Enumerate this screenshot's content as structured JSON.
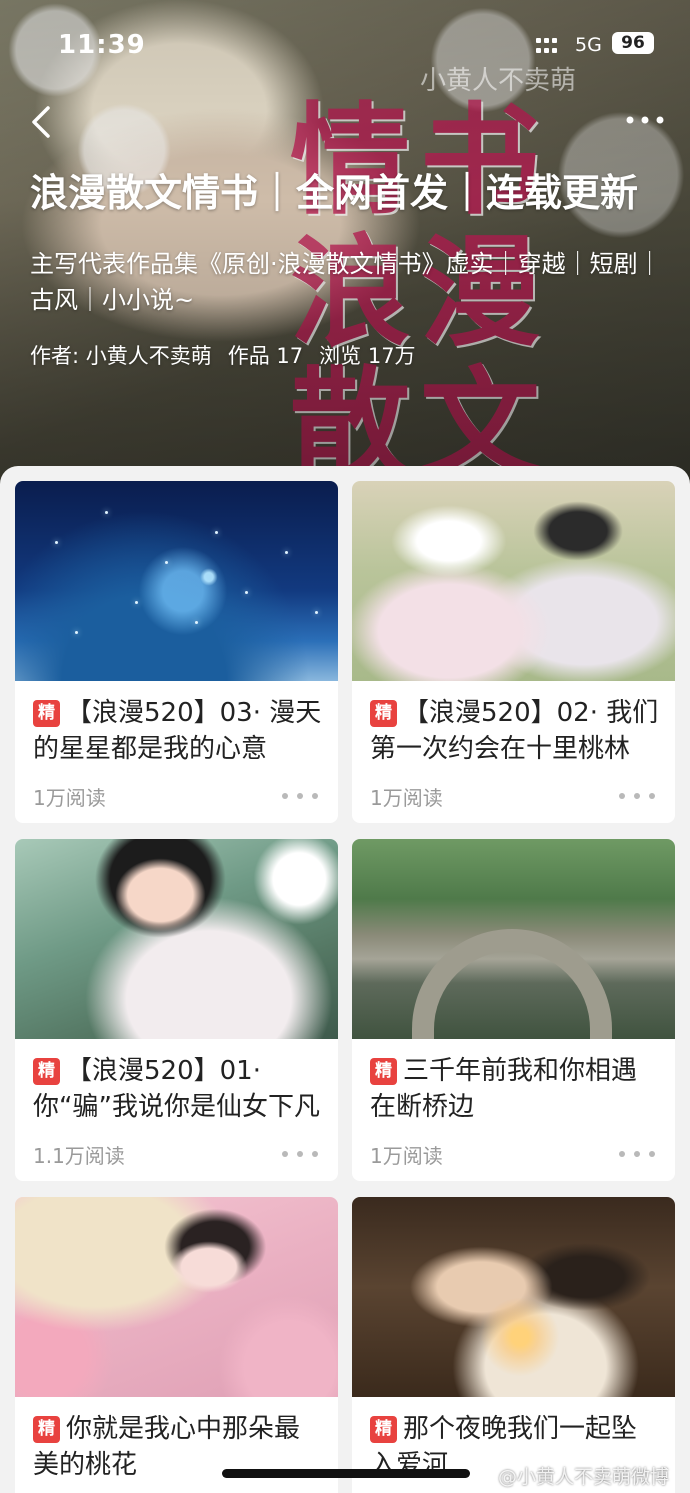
{
  "status_bar": {
    "time": "11:39",
    "network": "5G",
    "battery": "96"
  },
  "hero": {
    "watermark": "小黄人不卖萌",
    "art_text": "情书浪漫散文",
    "title": "浪漫散文情书｜全网首发｜连载更新",
    "description": "主写代表作品集《原创·浪漫散文情书》虚实｜穿越｜短剧｜古风｜小小说~",
    "author": "作者: 小黄人不卖萌",
    "works": "作品 17",
    "views": "浏览 17万"
  },
  "badge_label": "精",
  "cards": [
    {
      "title": "【浪漫520】03· 漫天的星星都是我的心意",
      "reads": "1万阅读",
      "thumb": "starry-sky-image"
    },
    {
      "title": "【浪漫520】02· 我们第一次约会在十里桃林",
      "reads": "1万阅读",
      "thumb": "hanfu-couple-image"
    },
    {
      "title": "【浪漫520】01· 你“骗”我说你是仙女下凡",
      "reads": "1.1万阅读",
      "thumb": "hanfu-lady-image"
    },
    {
      "title": "三千年前我和你相遇在断桥边",
      "reads": "1万阅读",
      "thumb": "stone-bridge-image"
    },
    {
      "title": "你就是我心中那朵最美的桃花",
      "reads": "",
      "thumb": "peach-blossom-image"
    },
    {
      "title": "那个夜晚我们一起坠入爱河",
      "reads": "",
      "thumb": "night-couple-image"
    }
  ],
  "bottom_watermark": "@小黄人不卖萌微博"
}
